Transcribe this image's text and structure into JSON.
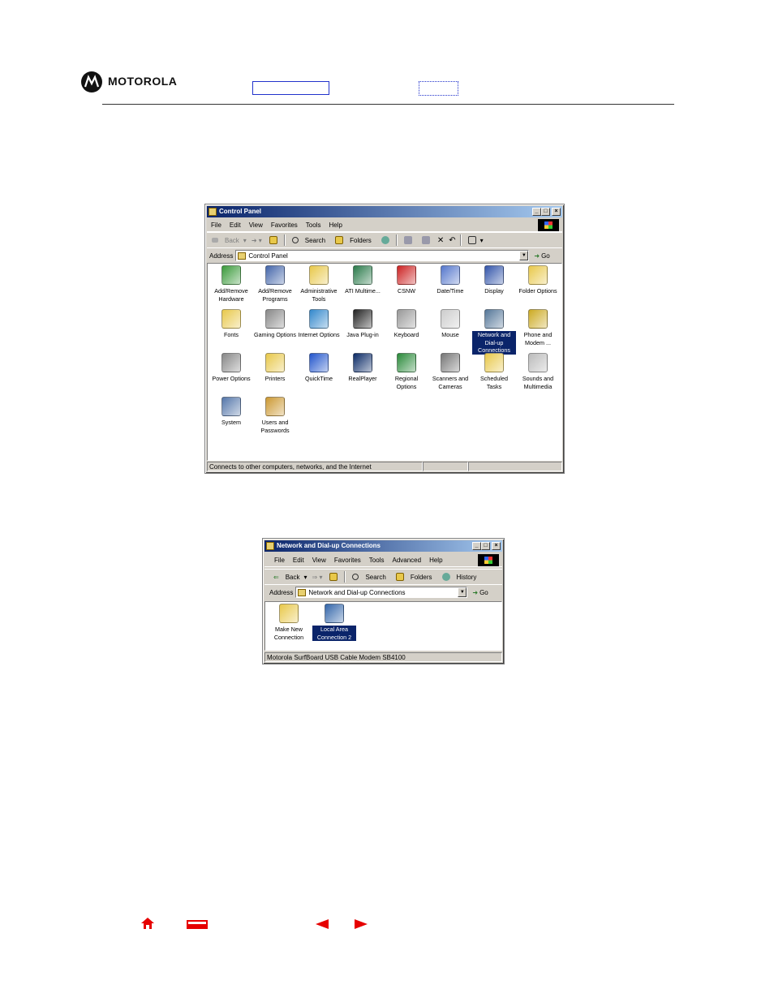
{
  "header": {
    "brand": "MOTOROLA"
  },
  "control_panel": {
    "title": "Control Panel",
    "menu": [
      "File",
      "Edit",
      "View",
      "Favorites",
      "Tools",
      "Help"
    ],
    "toolbar": {
      "back": "Back",
      "search": "Search",
      "folders": "Folders"
    },
    "address_label": "Address",
    "address_value": "Control Panel",
    "go": "Go",
    "items": [
      {
        "label": "Add/Remove Hardware",
        "icon": "add-remove-hardware-icon",
        "color": "#3a9a3a"
      },
      {
        "label": "Add/Remove Programs",
        "icon": "add-remove-programs-icon",
        "color": "#4466aa"
      },
      {
        "label": "Administrative Tools",
        "icon": "administrative-tools-icon",
        "color": "#e8c84a"
      },
      {
        "label": "ATI Multime...",
        "icon": "ati-multimedia-icon",
        "color": "#2a7a4a"
      },
      {
        "label": "CSNW",
        "icon": "csnw-icon",
        "color": "#cc2222"
      },
      {
        "label": "Date/Time",
        "icon": "date-time-icon",
        "color": "#5577cc"
      },
      {
        "label": "Display",
        "icon": "display-icon",
        "color": "#3355aa"
      },
      {
        "label": "Folder Options",
        "icon": "folder-options-icon",
        "color": "#e8c84a"
      },
      {
        "label": "Fonts",
        "icon": "fonts-icon",
        "color": "#e8c84a"
      },
      {
        "label": "Gaming Options",
        "icon": "gaming-options-icon",
        "color": "#888888"
      },
      {
        "label": "Internet Options",
        "icon": "internet-options-icon",
        "color": "#3388cc"
      },
      {
        "label": "Java Plug-in",
        "icon": "java-plugin-icon",
        "color": "#222222"
      },
      {
        "label": "Keyboard",
        "icon": "keyboard-icon",
        "color": "#999999"
      },
      {
        "label": "Mouse",
        "icon": "mouse-icon",
        "color": "#cccccc"
      },
      {
        "label": "Network and Dial-up Connections",
        "icon": "network-connections-icon",
        "color": "#557799"
      },
      {
        "label": "Phone and Modem ...",
        "icon": "phone-modem-icon",
        "color": "#ccaa22"
      },
      {
        "label": "Power Options",
        "icon": "power-options-icon",
        "color": "#888888"
      },
      {
        "label": "Printers",
        "icon": "printers-icon",
        "color": "#e8c84a"
      },
      {
        "label": "QuickTime",
        "icon": "quicktime-icon",
        "color": "#2255cc"
      },
      {
        "label": "RealPlayer",
        "icon": "realplayer-icon",
        "color": "#0a2a66"
      },
      {
        "label": "Regional Options",
        "icon": "regional-options-icon",
        "color": "#2a8a3a"
      },
      {
        "label": "Scanners and Cameras",
        "icon": "scanners-cameras-icon",
        "color": "#777777"
      },
      {
        "label": "Scheduled Tasks",
        "icon": "scheduled-tasks-icon",
        "color": "#e8c84a"
      },
      {
        "label": "Sounds and Multimedia",
        "icon": "sounds-multimedia-icon",
        "color": "#bbbbbb"
      },
      {
        "label": "System",
        "icon": "system-icon",
        "color": "#5577aa"
      },
      {
        "label": "Users and Passwords",
        "icon": "users-passwords-icon",
        "color": "#cc9933"
      }
    ],
    "selected_item": "Network and Dial-up Connections",
    "status": "Connects to other computers, networks, and the Internet"
  },
  "network_window": {
    "title": "Network and Dial-up Connections",
    "menu": [
      "File",
      "Edit",
      "View",
      "Favorites",
      "Tools",
      "Advanced",
      "Help"
    ],
    "toolbar": {
      "back": "Back",
      "search": "Search",
      "folders": "Folders",
      "history": "History"
    },
    "address_label": "Address",
    "address_value": "Network and Dial-up Connections",
    "go": "Go",
    "items": [
      {
        "label": "Make New Connection",
        "icon": "make-new-connection-icon",
        "color": "#e8c84a"
      },
      {
        "label": "Local Area Connection 2",
        "icon": "local-area-connection-icon",
        "color": "#3366aa"
      }
    ],
    "selected_item": "Local Area Connection 2",
    "status": "Motorola SurfBoard USB Cable Modem SB4100"
  },
  "nav": {
    "home_icon": "home-icon",
    "print_icon": "print-icon",
    "prev_icon": "previous-page-icon",
    "next_icon": "next-page-icon",
    "accent": "#e60000"
  }
}
